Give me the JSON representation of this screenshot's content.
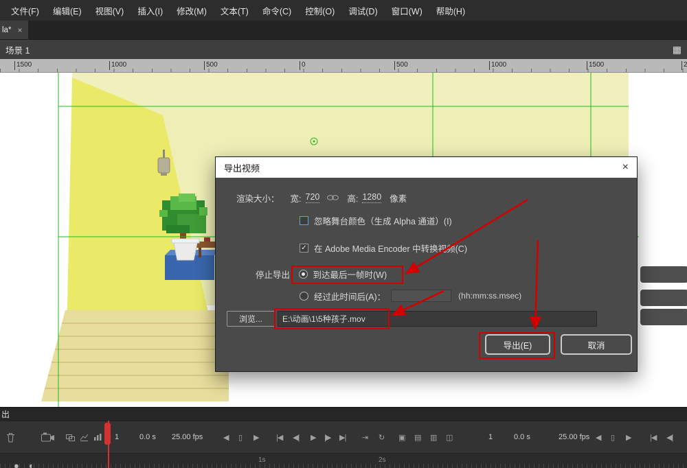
{
  "window": {
    "tab_label": "la*"
  },
  "menu": {
    "items": [
      "文件(F)",
      "编辑(E)",
      "视图(V)",
      "插入(I)",
      "修改(M)",
      "文本(T)",
      "命令(C)",
      "控制(O)",
      "调试(D)",
      "窗口(W)",
      "帮助(H)"
    ]
  },
  "scene_bar": {
    "scene_label": "场景 1"
  },
  "ruler": {
    "labels": [
      "1500",
      "1000",
      "500",
      "0",
      "500",
      "1000",
      "1500",
      "2"
    ]
  },
  "dialog": {
    "title": "导出视频",
    "render_size_label": "渲染大小：",
    "width_label": "宽:",
    "width_value": "720",
    "height_label": "高:",
    "height_value": "1280",
    "pixels_label": "像素",
    "ignore_stage_color_label": "忽略舞台颜色（生成 Alpha 通道）(I)",
    "media_encoder_label": "在 Adobe Media Encoder 中转换视频(C)",
    "stop_export_label": "停止导出：",
    "last_frame_option": "到达最后一帧时(W)",
    "elapsed_option": "经过此时间后(A)：",
    "time_value": "",
    "time_hint": "(hh:mm:ss.msec)",
    "browse_label": "浏览...",
    "path_value": "E:\\动画\\1\\5种孩子.mov",
    "export_label": "导出(E)",
    "cancel_label": "取消"
  },
  "timeline": {
    "left": {
      "frame": "1",
      "time": "0.0 s",
      "fps": "25.00 fps"
    },
    "right": {
      "frame": "1",
      "time": "0.0 s",
      "fps": "25.00 fps"
    },
    "ruler_marks": [
      "1s",
      "2s"
    ]
  },
  "output_panel": {
    "label": "出"
  },
  "icons": {
    "close": "×",
    "tab_close": "×",
    "edit_scene": "▦",
    "check": "✓",
    "step_back": "◀",
    "frame_box": "▯",
    "step_forward": "▶",
    "go_first": "|◀",
    "prev_frame": "◀|",
    "play": "▶",
    "next_frame": "|▶",
    "go_last": "▶|",
    "center_playhead": "⇥",
    "loop": "↻",
    "onion_skin": "▣",
    "onion_outline": "▤",
    "edit_multiframe": "▥",
    "marker_range": "◫",
    "layer_dot": "●",
    "layer_half_dot": "◐"
  },
  "colors": {
    "annotation_red": "#d40000",
    "guide_green": "#1ebc1e",
    "wall_yellow": "#eaea68",
    "pale_yellow": "#f0f0bc",
    "focus_blue": "#6e9fd4"
  }
}
